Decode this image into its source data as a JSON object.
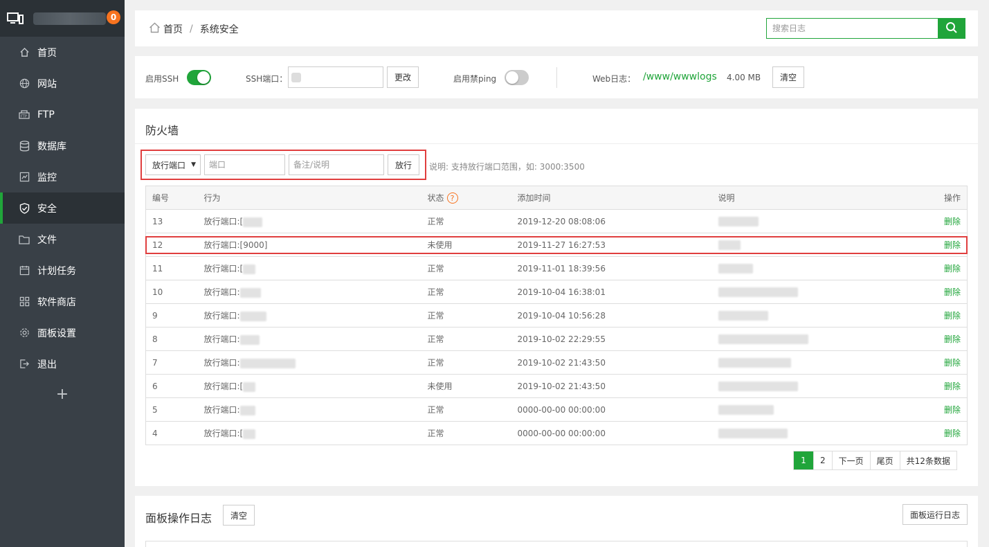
{
  "sidebar": {
    "badge": "0",
    "items": [
      {
        "label": "首页",
        "icon": "home-icon"
      },
      {
        "label": "网站",
        "icon": "globe-icon"
      },
      {
        "label": "FTP",
        "icon": "ftp-icon"
      },
      {
        "label": "数据库",
        "icon": "database-icon"
      },
      {
        "label": "监控",
        "icon": "monitor-chart-icon"
      },
      {
        "label": "安全",
        "icon": "shield-icon",
        "active": true
      },
      {
        "label": "文件",
        "icon": "folder-icon"
      },
      {
        "label": "计划任务",
        "icon": "calendar-icon"
      },
      {
        "label": "软件商店",
        "icon": "grid-icon"
      },
      {
        "label": "面板设置",
        "icon": "gear-icon"
      },
      {
        "label": "退出",
        "icon": "logout-icon"
      }
    ],
    "add": "+"
  },
  "header": {
    "breadcrumb_home": "首页",
    "breadcrumb_sep": "/",
    "breadcrumb_current": "系统安全",
    "search_placeholder": "搜索日志"
  },
  "settings": {
    "ssh_label": "启用SSH",
    "ssh_enabled": true,
    "ssh_port_label": "SSH端口：",
    "change_btn": "更改",
    "ping_label": "启用禁ping",
    "ping_enabled": false,
    "weblog_label": "Web日志：",
    "weblog_path": "/www/wwwlogs",
    "weblog_size": "4.00 MB",
    "clear_btn": "清空"
  },
  "firewall": {
    "title": "防火墙",
    "action_select": "放行端口",
    "port_placeholder": "端口",
    "remark_placeholder": "备注/说明",
    "submit_btn": "放行",
    "note": "说明: 支持放行端口范围，如: 3000:3500",
    "columns": [
      "编号",
      "行为",
      "状态",
      "添加时间",
      "说明",
      "操作"
    ],
    "delete_label": "删除",
    "rows": [
      {
        "id": "13",
        "action": "放行端口:[",
        "status": "正常",
        "time": "2019-12-20 08:08:06"
      },
      {
        "id": "12",
        "action": "放行端口:[9000]",
        "status": "未使用",
        "time": "2019-11-27 16:27:53"
      },
      {
        "id": "11",
        "action": "放行端口:[",
        "status": "正常",
        "time": "2019-11-01 18:39:56"
      },
      {
        "id": "10",
        "action": "放行端口:",
        "status": "正常",
        "time": "2019-10-04 16:38:01"
      },
      {
        "id": "9",
        "action": "放行端口:",
        "status": "正常",
        "time": "2019-10-04 10:56:28"
      },
      {
        "id": "8",
        "action": "放行端口:",
        "status": "正常",
        "time": "2019-10-02 22:29:55"
      },
      {
        "id": "7",
        "action": "放行端口:",
        "status": "正常",
        "time": "2019-10-02 21:43:50"
      },
      {
        "id": "6",
        "action": "放行端口:[",
        "status": "未使用",
        "time": "2019-10-02 21:43:50"
      },
      {
        "id": "5",
        "action": "放行端口:",
        "status": "正常",
        "time": "0000-00-00 00:00:00"
      },
      {
        "id": "4",
        "action": "放行端口:[",
        "status": "正常",
        "time": "0000-00-00 00:00:00"
      }
    ],
    "pager": {
      "current": "1",
      "page2": "2",
      "next": "下一页",
      "last": "尾页",
      "total": "共12条数据"
    }
  },
  "oplog": {
    "title": "面板操作日志",
    "clear_btn": "清空",
    "run_log_btn": "面板运行日志"
  },
  "colors": {
    "accent": "#20a53a",
    "sidebar": "#394047",
    "badge": "#f7731f",
    "highlight": "#e03e3e"
  }
}
